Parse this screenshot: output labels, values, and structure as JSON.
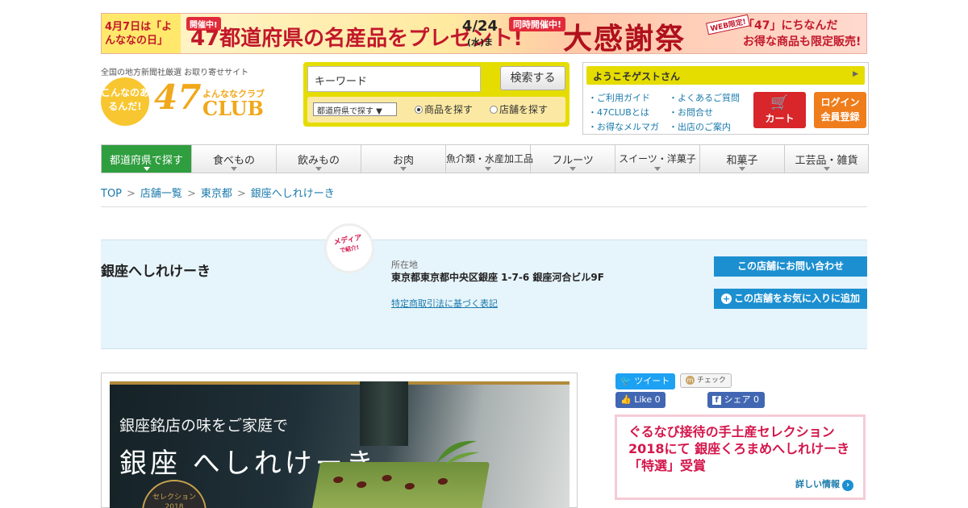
{
  "banner": {
    "left_text": "4月7日は「よんななの日」",
    "sale_tag": "開催中!",
    "main": "47都道府県の名産品をプレゼント!",
    "date": "4/24",
    "date_sub": "(水)まで!",
    "concurrent_tag": "同時開催中!",
    "kansha": "大感謝祭",
    "web_tag": "WEB限定!",
    "right_line1": "「47」にちなんだ",
    "right_line2": "お得な商品も限定販売!"
  },
  "header": {
    "tagline": "全国の地方新聞社厳選 お取り寄せサイト",
    "logo_circle": "こんなのあるんだ!",
    "logo_num": "47",
    "logo_sub": "よんななクラブ",
    "logo_club": "CLUB"
  },
  "search": {
    "keyword_value": "キーワード",
    "button": "検索する",
    "pref_select": "都道府県で探す ▼",
    "radio_products": "商品を探す",
    "radio_shops": "店舗を探す"
  },
  "user": {
    "welcome": "ようこそゲストさん",
    "links": [
      "ご利用ガイド",
      "よくあるご質問",
      "47CLUBとは",
      "お問合せ",
      "お得なメルマガ",
      "出店のご案内"
    ],
    "cart": "カート",
    "login_line1": "ログイン",
    "login_line2": "会員登録"
  },
  "nav": {
    "items": [
      "都道府県で探す",
      "食べもの",
      "飲みもの",
      "お肉",
      "魚介類・水産加工品",
      "フルーツ",
      "スイーツ・洋菓子",
      "和菓子",
      "工芸品・雑貨"
    ]
  },
  "breadcrumb": [
    "TOP",
    "店舗一覧",
    "東京都",
    "銀座へしれけーき"
  ],
  "shop": {
    "name": "銀座へしれけーき",
    "media_badge": "メディア",
    "media_badge_sub": "で紹介!",
    "address_label": "所在地",
    "address": "東京都東京都中央区銀座 1-7-6 銀座河合ビル9F",
    "legal_link": "特定商取引法に基づく表記",
    "contact_button": "この店舗にお問い合わせ",
    "favorite_button": "この店舗をお気に入りに追加"
  },
  "hero": {
    "line1": "銀座銘店の味をご家庭で",
    "line2": "銀座 へしれけーき",
    "badge": "セレクション 2018"
  },
  "social": {
    "tweet": "ツイート",
    "check": "チェック",
    "like": "Like 0",
    "share": "シェア 0"
  },
  "promo": {
    "text": "ぐるなび接待の手土産セレクション2018にて 銀座くろまめへしれけーき「特選」受賞",
    "more": "詳しい情報"
  },
  "colors": {
    "accent_green": "#2f9e3f",
    "brand_yellow": "#e5dc00",
    "button_blue": "#1c8fd0",
    "promo_pink": "#d4164b"
  }
}
